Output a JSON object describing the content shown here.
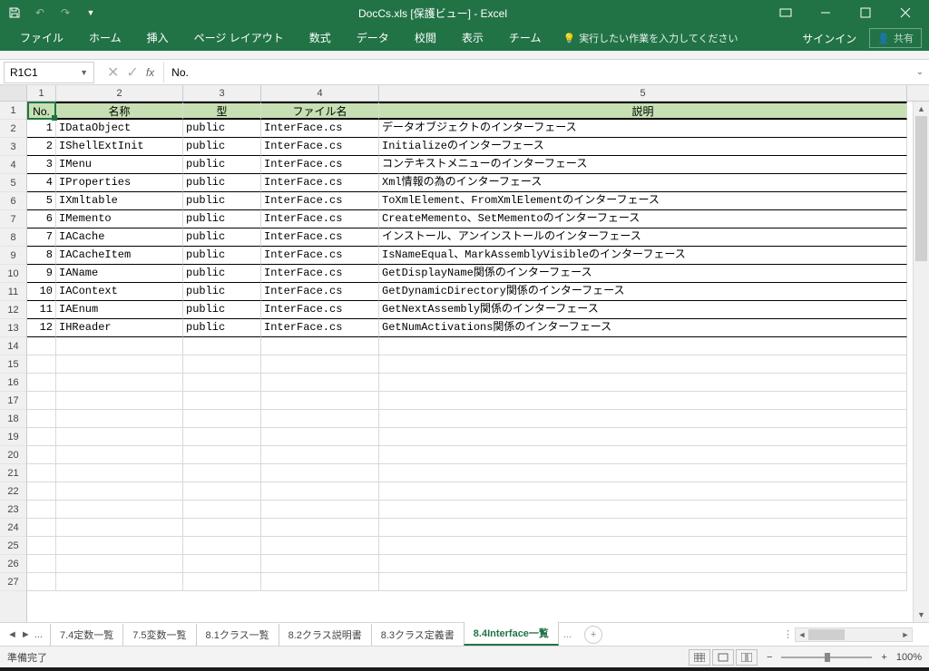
{
  "title": "DocCs.xls  [保護ビュー] - Excel",
  "ribbon": {
    "file": "ファイル",
    "tabs": [
      "ホーム",
      "挿入",
      "ページ レイアウト",
      "数式",
      "データ",
      "校閲",
      "表示",
      "チーム"
    ],
    "tell_me": "実行したい作業を入力してください",
    "signin": "サインイン",
    "share": "共有"
  },
  "namebox": "R1C1",
  "formula": "No.",
  "col_numbers": [
    "1",
    "2",
    "3",
    "4",
    "5"
  ],
  "headers": {
    "no": "No.",
    "name": "名称",
    "type": "型",
    "file": "ファイル名",
    "desc": "説明"
  },
  "rows": [
    {
      "no": "1",
      "name": "IDataObject",
      "type": "public",
      "file": "InterFace.cs",
      "desc": "データオブジェクトのインターフェース"
    },
    {
      "no": "2",
      "name": "IShellExtInit",
      "type": "public",
      "file": "InterFace.cs",
      "desc": "Initializeのインターフェース"
    },
    {
      "no": "3",
      "name": "IMenu",
      "type": "public",
      "file": "InterFace.cs",
      "desc": "コンテキストメニューのインターフェース"
    },
    {
      "no": "4",
      "name": "IProperties",
      "type": "public",
      "file": "InterFace.cs",
      "desc": "Xml情報の為のインターフェース"
    },
    {
      "no": "5",
      "name": "IXmltable",
      "type": "public",
      "file": "InterFace.cs",
      "desc": "ToXmlElement、FromXmlElementのインターフェース"
    },
    {
      "no": "6",
      "name": "IMemento",
      "type": "public",
      "file": "InterFace.cs",
      "desc": "CreateMemento、SetMementoのインターフェース"
    },
    {
      "no": "7",
      "name": "IACache",
      "type": "public",
      "file": "InterFace.cs",
      "desc": "インストール、アンインストールのインターフェース"
    },
    {
      "no": "8",
      "name": "IACacheItem",
      "type": "public",
      "file": "InterFace.cs",
      "desc": "IsNameEqual、MarkAssemblyVisibleのインターフェース"
    },
    {
      "no": "9",
      "name": "IAName",
      "type": "public",
      "file": "InterFace.cs",
      "desc": "GetDisplayName関係のインターフェース"
    },
    {
      "no": "10",
      "name": "IAContext",
      "type": "public",
      "file": "InterFace.cs",
      "desc": "GetDynamicDirectory関係のインターフェース"
    },
    {
      "no": "11",
      "name": "IAEnum",
      "type": "public",
      "file": "InterFace.cs",
      "desc": "GetNextAssembly関係のインターフェース"
    },
    {
      "no": "12",
      "name": "IHReader",
      "type": "public",
      "file": "InterFace.cs",
      "desc": "GetNumActivations関係のインターフェース"
    }
  ],
  "empty_rows": 14,
  "row_labels": [
    "1",
    "2",
    "3",
    "4",
    "5",
    "6",
    "7",
    "8",
    "9",
    "10",
    "11",
    "12",
    "13",
    "14",
    "15",
    "16",
    "17",
    "18",
    "19",
    "20",
    "21",
    "22",
    "23",
    "24",
    "25",
    "26",
    "27"
  ],
  "sheets": {
    "ellipsis": "...",
    "tabs": [
      "7.4定数一覧",
      "7.5変数一覧",
      "8.1クラス一覧",
      "8.2クラス説明書",
      "8.3クラス定義書",
      "8.4Interface一覧"
    ],
    "active": 5
  },
  "status": {
    "ready": "準備完了",
    "zoom": "100%"
  }
}
